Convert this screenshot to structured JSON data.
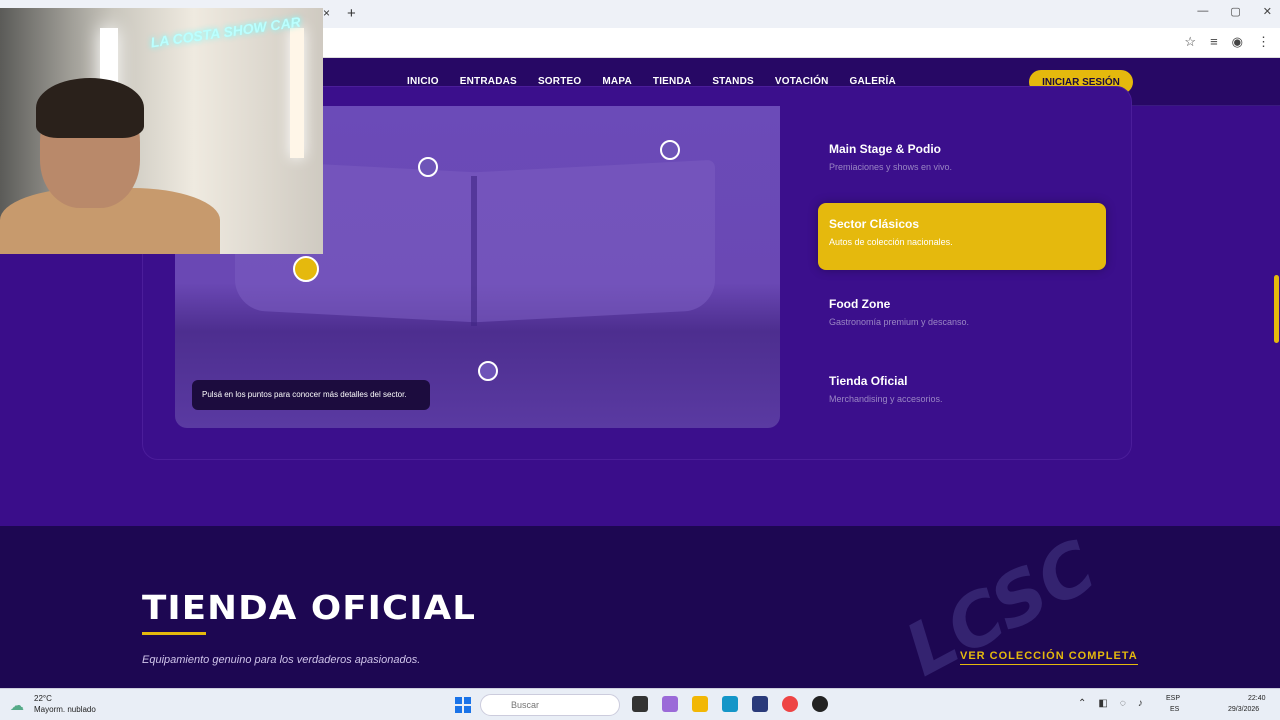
{
  "browser": {
    "tab_close_icon": "×",
    "new_tab_icon": "+",
    "window_controls": [
      "—",
      "▢",
      "✕"
    ],
    "toolbar_icons": [
      "☆",
      "≡",
      "◉",
      "⋮"
    ]
  },
  "webcam": {
    "neon_sign": "LA COSTA SHOW CAR"
  },
  "nav": {
    "links": [
      "INICIO",
      "ENTRADAS",
      "SORTEO",
      "MAPA",
      "TIENDA",
      "STANDS",
      "VOTACIÓN",
      "GALERÍA"
    ],
    "login_label": "INICIAR SESIÓN"
  },
  "map": {
    "tooltip": "Pulsá en los puntos para conocer más detalles del sector.",
    "sectors": [
      {
        "title": "Main Stage & Podio",
        "desc": "Premiaciones y shows en vivo.",
        "active": false
      },
      {
        "title": "Sector Clásicos",
        "desc": "Autos de colección nacionales.",
        "active": true
      },
      {
        "title": "Food Zone",
        "desc": "Gastronomía premium y descanso.",
        "active": false
      },
      {
        "title": "Tienda Oficial",
        "desc": "Merchandising y accesorios.",
        "active": false
      }
    ]
  },
  "store": {
    "title": "TIENDA OFICIAL",
    "subtitle": "Equipamiento genuino para los verdaderos apasionados.",
    "link": "VER COLECCIÓN COMPLETA",
    "watermark": "LCSC"
  },
  "taskbar": {
    "temperature": "22°C",
    "weather": "Mayorm. nublado",
    "search_placeholder": "Buscar",
    "lang_top": "ESP",
    "lang_bottom": "ES",
    "time": "22:40",
    "date": "29/3/2026"
  },
  "colors": {
    "accent": "#e5b90d",
    "primary_bg": "#3a0d8a",
    "dark_bg": "#1d0752"
  }
}
